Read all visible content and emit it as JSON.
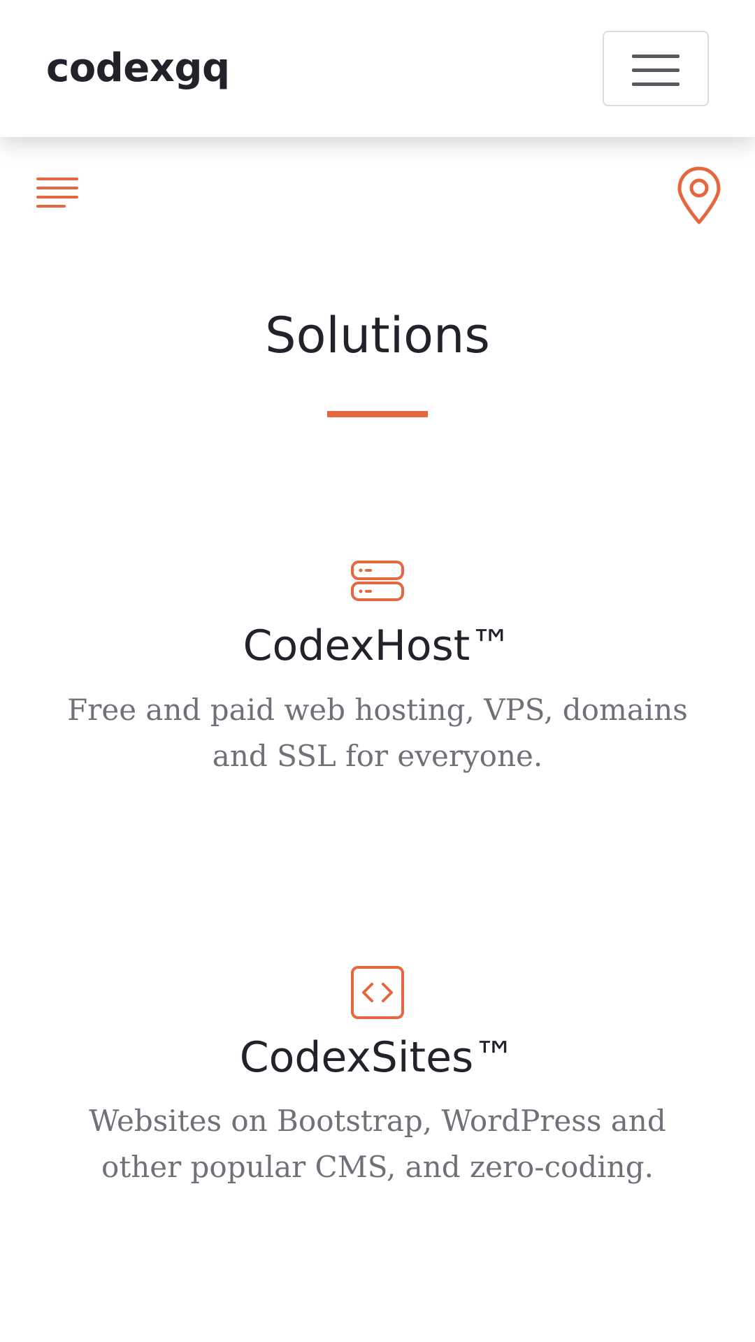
{
  "navbar": {
    "brand": "codexgq",
    "toggler_icon": "hamburger-menu-icon"
  },
  "subbar": {
    "menu_icon": "text-align-menu-icon",
    "location_icon": "map-pin-icon"
  },
  "section": {
    "title": "Solutions"
  },
  "features": [
    {
      "icon": "server-icon",
      "title": "CodexHost™",
      "description": "Free and paid web hosting, VPS, domains and SSL for everyone."
    },
    {
      "icon": "code-brackets-icon",
      "title": "CodexSites™",
      "description": "Websites on Bootstrap, WordPress and other popular CMS, and zero-coding."
    }
  ],
  "colors": {
    "accent": "#e5673d",
    "heading": "#22232a",
    "body_text": "#6f7178",
    "border": "#dcdcdc"
  }
}
